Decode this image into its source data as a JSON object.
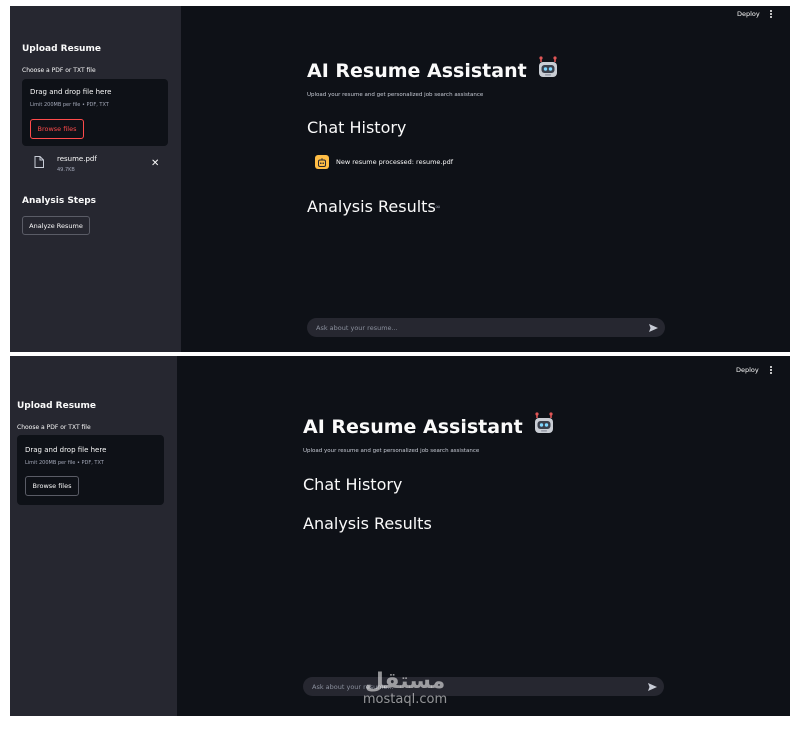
{
  "screens": [
    {
      "sidebar": {
        "upload_title": "Upload Resume",
        "upload_caption": "Choose a PDF or TXT file",
        "dropzone_title": "Drag and drop file here",
        "dropzone_limit": "Limit 200MB per file • PDF, TXT",
        "browse_label": "Browse files",
        "file": {
          "name": "resume.pdf",
          "size": "49.7KB",
          "remove_glyph": "✕"
        },
        "steps_title": "Analysis Steps",
        "analyze_label": "Analyze Resume"
      },
      "toolbar": {
        "deploy_label": "Deploy"
      },
      "main": {
        "title": "AI Resume Assistant",
        "subtitle": "Upload your resume and get personalized job search assistance",
        "chat_history_heading": "Chat History",
        "message": "New resume processed: resume.pdf",
        "analysis_heading": "Analysis Results",
        "link_glyph": "∞"
      },
      "chat_input": {
        "placeholder": "Ask about your resume..."
      }
    },
    {
      "sidebar": {
        "upload_title": "Upload Resume",
        "upload_caption": "Choose a PDF or TXT file",
        "dropzone_title": "Drag and drop file here",
        "dropzone_limit": "Limit 200MB per file • PDF, TXT",
        "browse_label": "Browse files"
      },
      "toolbar": {
        "deploy_label": "Deploy"
      },
      "main": {
        "title": "AI Resume Assistant",
        "subtitle": "Upload your resume and get personalized job search assistance",
        "chat_history_heading": "Chat History",
        "analysis_heading": "Analysis Results"
      },
      "chat_input": {
        "placeholder": "Ask about your resume..."
      }
    }
  ],
  "watermark": {
    "arabic": "مستقل",
    "latin": "mostaql.com"
  },
  "colors": {
    "main_bg": "#0e1117",
    "sidebar_bg": "#262730",
    "accent": "#ff4b4b",
    "avatar": "#ffbd45"
  },
  "icons": [
    "robot-icon",
    "file-icon",
    "close-icon",
    "kebab-menu-icon",
    "send-icon",
    "assistant-avatar-icon",
    "link-icon"
  ]
}
